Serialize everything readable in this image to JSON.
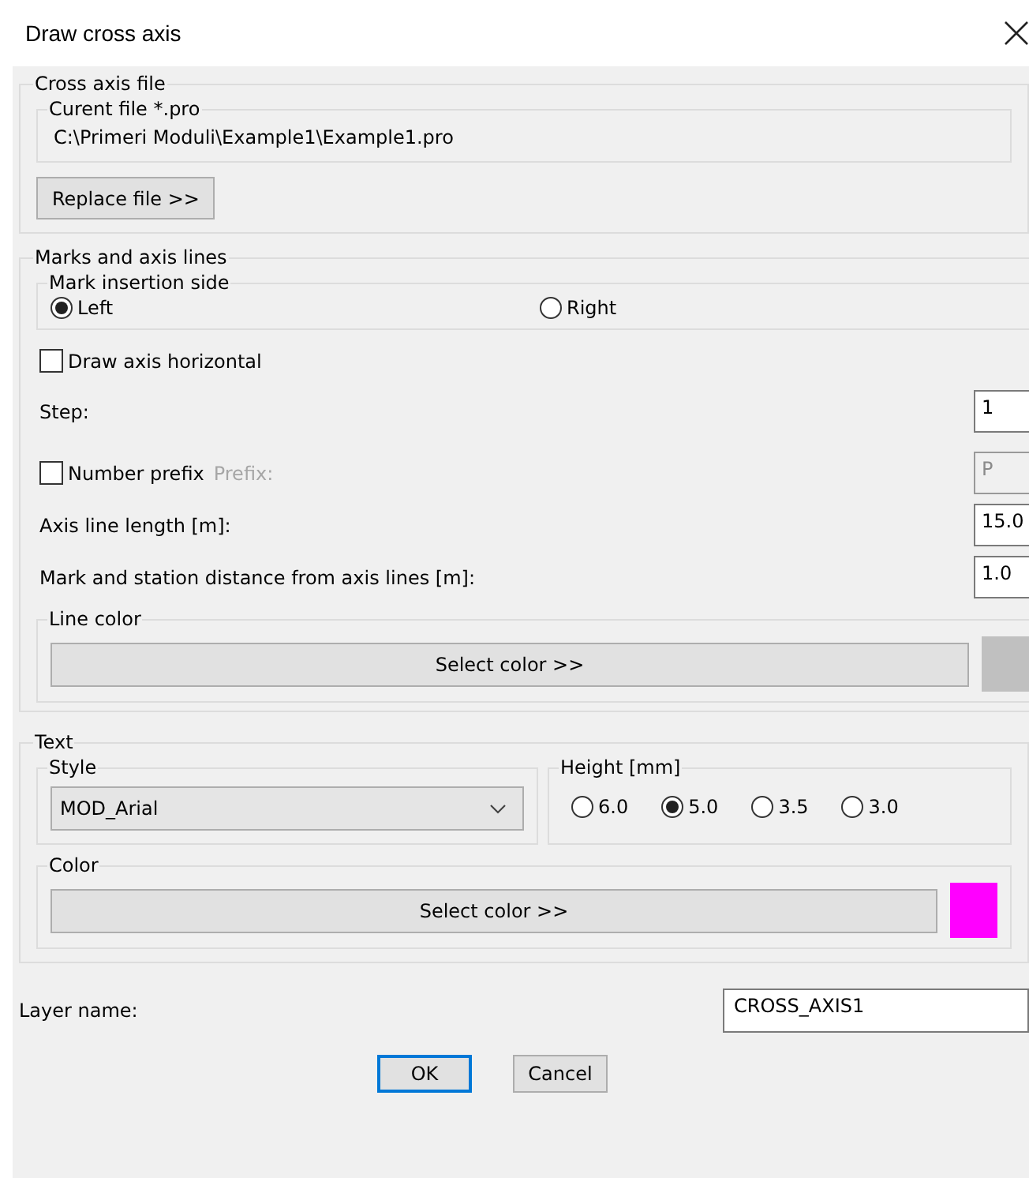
{
  "window": {
    "title": "Draw cross axis"
  },
  "cross_axis_file": {
    "legend": "Cross axis file",
    "current_file_legend": "Curent file *.pro",
    "current_file": "C:\\Primeri Moduli\\Example1\\Example1.pro",
    "replace_button": "Replace file >>"
  },
  "marks": {
    "legend": "Marks and axis lines",
    "side_legend": "Mark insertion side",
    "side_options": [
      {
        "label": "Left",
        "selected": true
      },
      {
        "label": "Right",
        "selected": false
      }
    ],
    "draw_horizontal": {
      "label": "Draw axis horizontal",
      "checked": false
    },
    "step": {
      "label": "Step:",
      "value": "1"
    },
    "number_prefix": {
      "label": "Number prefix",
      "checked": false,
      "prefix_label": "Prefix:",
      "prefix_value": "P"
    },
    "axis_length": {
      "label": "Axis line length [m]:",
      "value": "15.0"
    },
    "distance": {
      "label": "Mark and station distance from axis lines [m]:",
      "value": "1.0"
    },
    "line_color": {
      "legend": "Line color",
      "button": "Select color >>",
      "color": "#c0c0c0"
    }
  },
  "text": {
    "legend": "Text",
    "style_legend": "Style",
    "style_value": "MOD_Arial",
    "height_legend": "Height [mm]",
    "heights": [
      {
        "label": "6.0",
        "selected": false
      },
      {
        "label": "5.0",
        "selected": true
      },
      {
        "label": "3.5",
        "selected": false
      },
      {
        "label": "3.0",
        "selected": false
      }
    ],
    "color": {
      "legend": "Color",
      "button": "Select color >>",
      "color": "#ff00ff"
    }
  },
  "layer": {
    "label": "Layer name:",
    "value": "CROSS_AXIS1"
  },
  "buttons": [
    "OK",
    "Cancel"
  ]
}
